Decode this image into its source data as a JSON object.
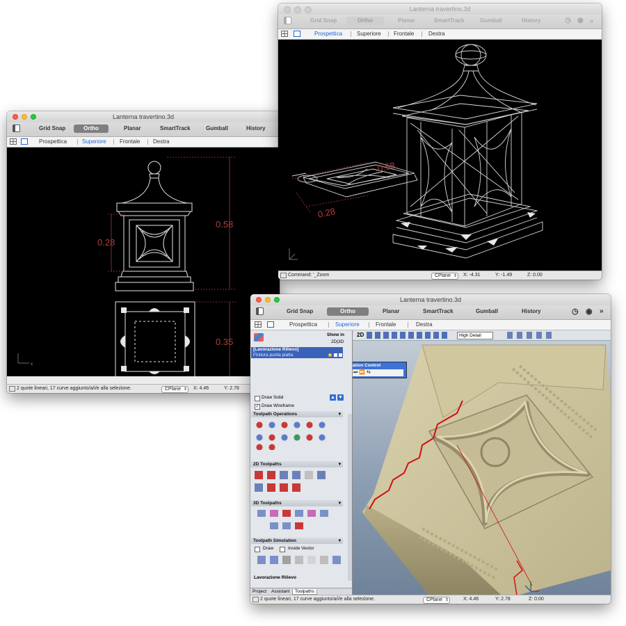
{
  "windows": {
    "left": {
      "title": "Lanterna travertino.3d",
      "toolbar": [
        "Grid Snap",
        "Ortho",
        "Planar",
        "SmartTrack",
        "Gumball",
        "History"
      ],
      "selected_tool": "Ortho",
      "tabs": [
        "Prospettica",
        "Superiore",
        "Frontale",
        "Destra"
      ],
      "active_tab": "Superiore",
      "dimensions": [
        "0.58",
        "0.28",
        "0.35"
      ],
      "status": {
        "message": "2 quote lineari, 17 curve aggiunto/a/i/e alla selezione.",
        "cplane": "CPlane",
        "x": "X: 4.46",
        "y": "Y: 2.78"
      }
    },
    "top": {
      "title": "Lanterna travertino.3d",
      "toolbar": [
        "Grid Snap",
        "Ortho",
        "Planar",
        "SmartTrack",
        "Gumball",
        "History"
      ],
      "selected_tool": "Ortho",
      "tabs": [
        "Prospettica",
        "Superiore",
        "Frontale",
        "Destra"
      ],
      "active_tab": "Prospettica",
      "dimensions": [
        "0.58",
        "0.28"
      ],
      "status": {
        "command": "Command: '_Zoom",
        "cplane": "CPlane",
        "x": "X: -4.31",
        "y": "Y: -1.49",
        "z": "Z: 0.00"
      }
    },
    "front": {
      "title": "Lanterna travertino.3d",
      "toolbar": [
        "Grid Snap",
        "Ortho",
        "Planar",
        "SmartTrack",
        "Gumball",
        "History"
      ],
      "selected_tool": "Ortho",
      "tabs": [
        "Prospettica",
        "Superiore",
        "Frontale",
        "Destra"
      ],
      "active_tab": "Superiore",
      "status": {
        "message": "2 quote lineari, 17 curve aggiunto/a/i/e alla selezione.",
        "cplane": "CPlane",
        "x": "X: 4.46",
        "y": "Y: 2.78",
        "z": "Z: 0.00"
      }
    }
  },
  "panel": {
    "show_in": "Show in",
    "mode": "2D|3D",
    "view_mode": "2D",
    "detail": "High Detail",
    "toolpath_selected": "[Lavorazione Rilievo]",
    "toolpath_sub": "Finitura punta piatta",
    "simulation_title": "Simulation Control",
    "draw_solid": "Draw Solid",
    "draw_wireframe": "Draw Wireframe",
    "sections": [
      "Toolpath Operations",
      "2D Toolpaths",
      "3D Toolpaths",
      "Toolpath Simulation"
    ],
    "sim_draw": "Draw",
    "sim_inside": "Inside Vector",
    "footer_title": "Lavorazione Rilievo",
    "bottom_tabs": [
      "Project",
      "Assistant",
      "Toolpaths"
    ]
  },
  "colors": {
    "selected_blue": "#1f63d6",
    "dimension_red": "#b03a3a",
    "stone": "#cdc49e",
    "selection_red": "#d01010"
  }
}
